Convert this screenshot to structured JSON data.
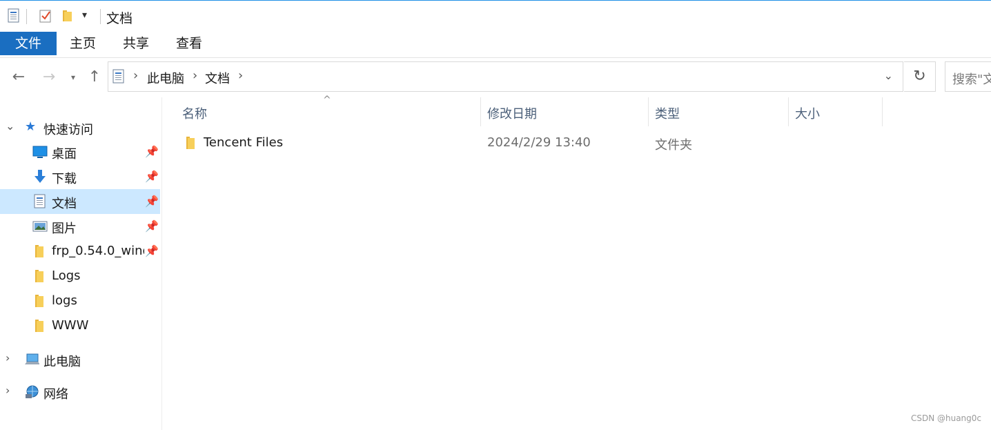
{
  "window": {
    "title": "文档"
  },
  "ribbon": {
    "tabs": [
      "文件",
      "主页",
      "共享",
      "查看"
    ]
  },
  "address": {
    "segments": [
      "此电脑",
      "文档"
    ],
    "search_placeholder": "搜索\"文"
  },
  "sidebar": {
    "quick_access": "快速访问",
    "items": [
      {
        "label": "桌面",
        "icon": "desktop-icon",
        "pinned": true
      },
      {
        "label": "下载",
        "icon": "download-icon",
        "pinned": true
      },
      {
        "label": "文档",
        "icon": "document-icon",
        "pinned": true,
        "selected": true
      },
      {
        "label": "图片",
        "icon": "pictures-icon",
        "pinned": true
      },
      {
        "label": "frp_0.54.0_wind",
        "icon": "folder-icon",
        "pinned": true
      },
      {
        "label": "Logs",
        "icon": "folder-icon",
        "pinned": false
      },
      {
        "label": "logs",
        "icon": "folder-icon",
        "pinned": false
      },
      {
        "label": "WWW",
        "icon": "folder-icon",
        "pinned": false
      }
    ],
    "this_pc": "此电脑",
    "network": "网络"
  },
  "columns": {
    "name": "名称",
    "modified": "修改日期",
    "type": "类型",
    "size": "大小"
  },
  "files": [
    {
      "name": "Tencent Files",
      "modified": "2024/2/29 13:40",
      "type": "文件夹",
      "size": ""
    }
  ],
  "watermark": "CSDN @huang0c",
  "colors": {
    "accent": "#1a6ec1",
    "selection": "#cce8ff",
    "folder": "#f7cf5a"
  }
}
